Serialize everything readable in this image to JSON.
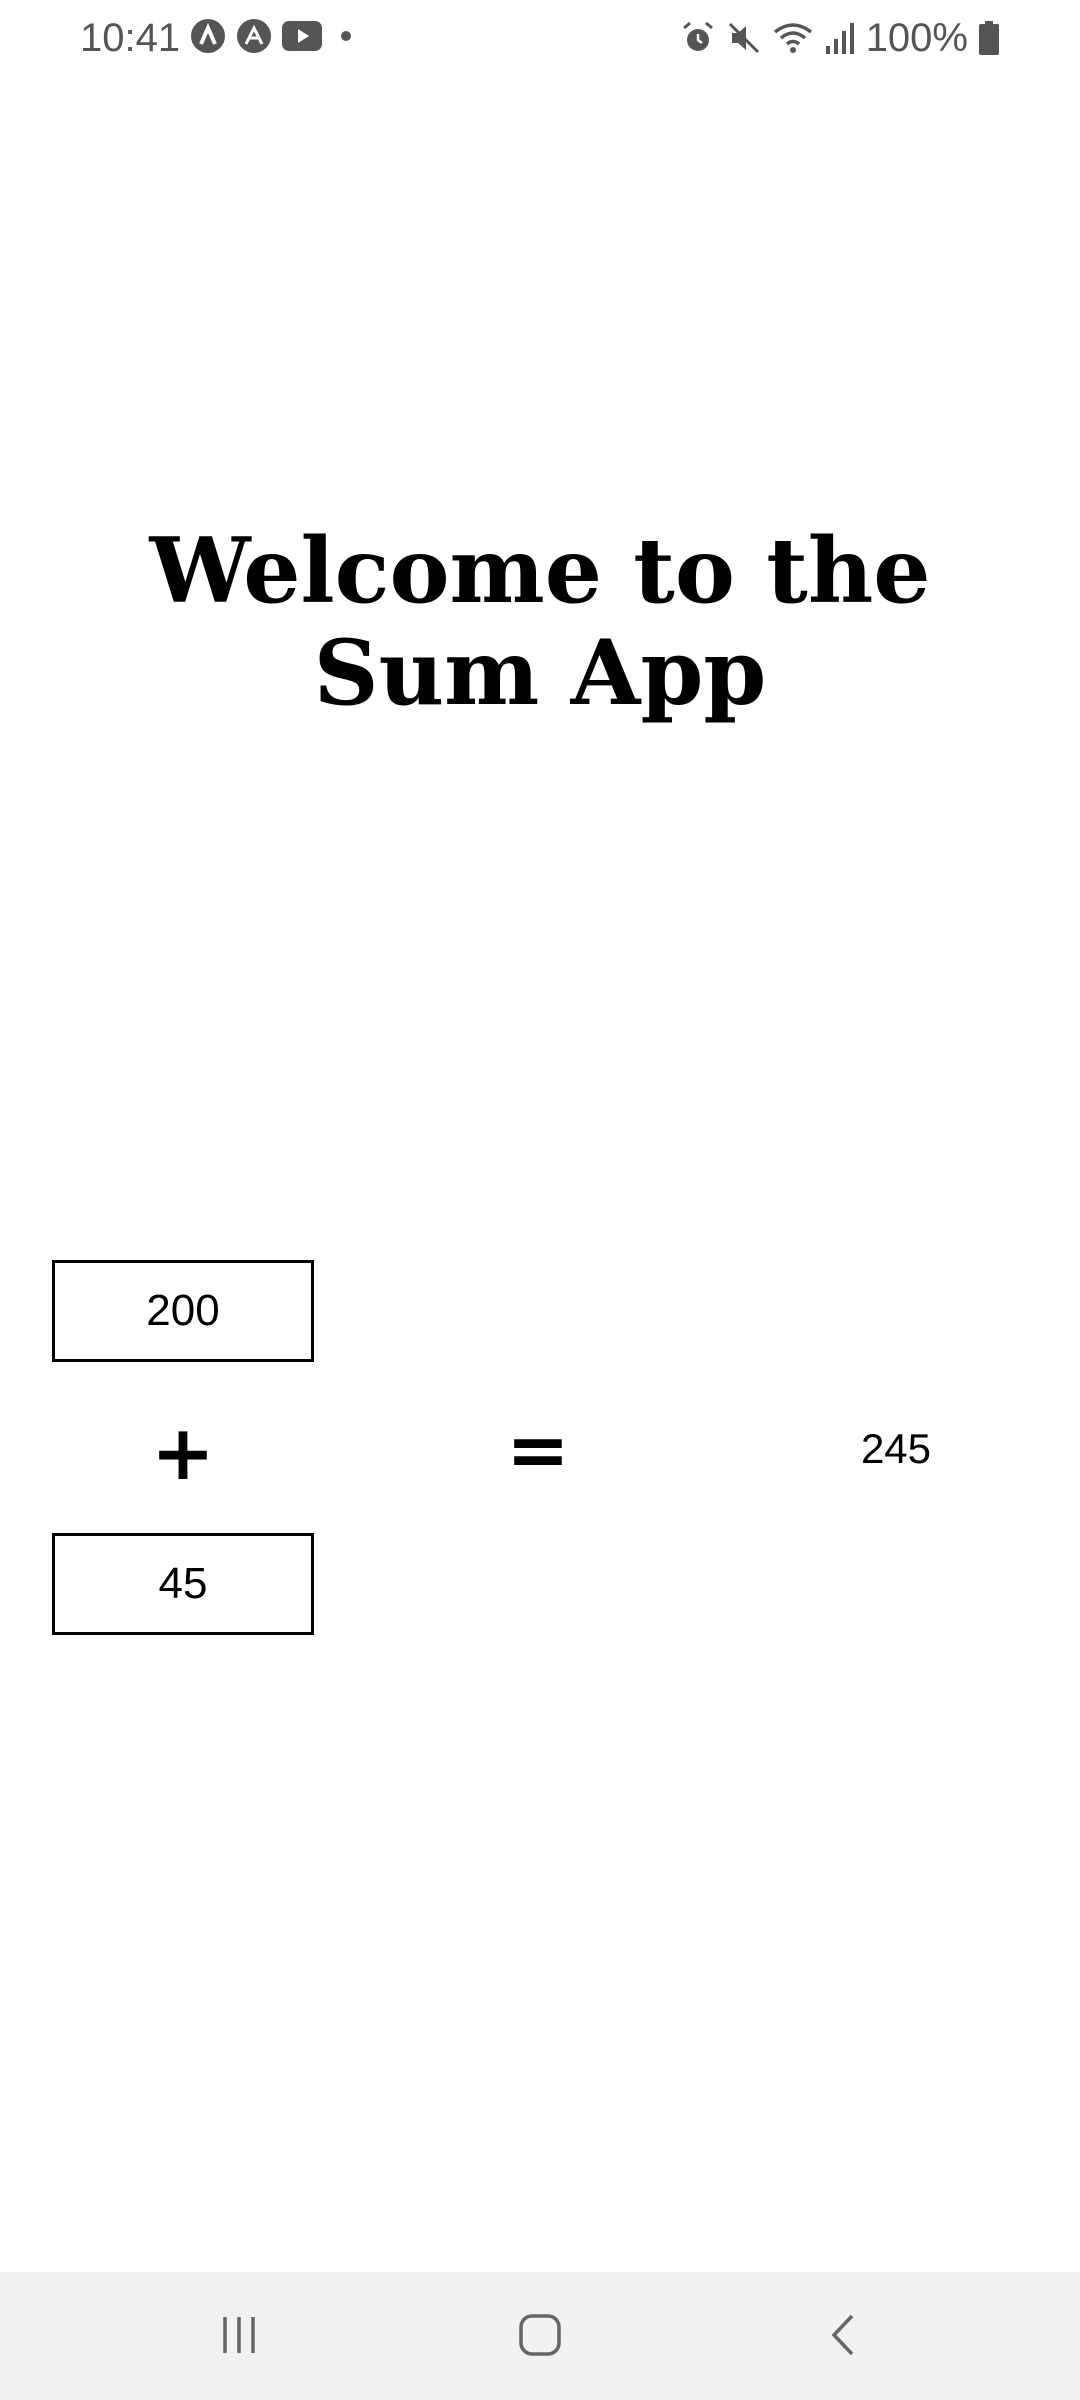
{
  "status_bar": {
    "time": "10:41",
    "battery": "100%",
    "left_icons": [
      "app-a-icon",
      "app-b-icon",
      "youtube-icon",
      "notification-dot-icon"
    ],
    "right_icons": [
      "alarm-icon",
      "mute-icon",
      "wifi-icon",
      "signal-icon",
      "battery-icon"
    ]
  },
  "page": {
    "title_line1": "Welcome to the",
    "title_line2": "Sum App"
  },
  "calculator": {
    "input_a": "200",
    "input_b": "45",
    "plus": "+",
    "equals": "=",
    "result": "245"
  },
  "nav": {
    "icons": [
      "recent-apps-icon",
      "home-icon",
      "back-icon"
    ]
  },
  "colors": {
    "background": "#ffffff",
    "nav_bar": "#f1f1f1",
    "status_text": "#555555"
  }
}
